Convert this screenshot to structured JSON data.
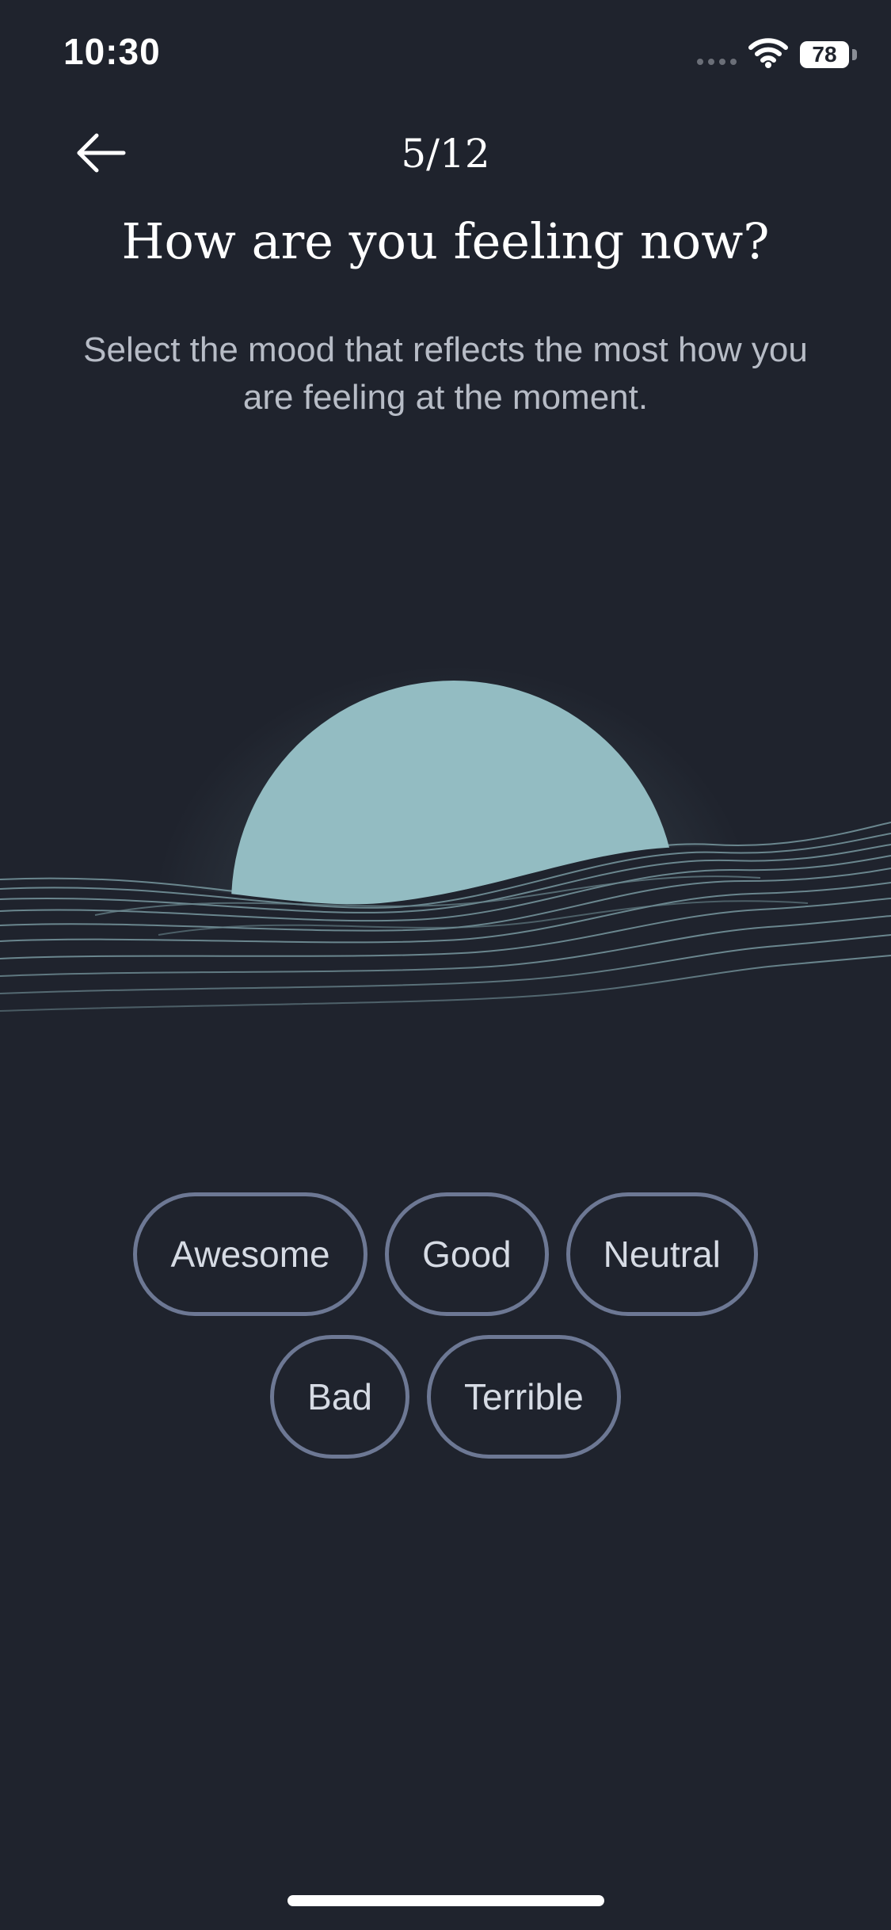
{
  "status_bar": {
    "time": "10:30",
    "battery": "78"
  },
  "header": {
    "progress": "5/12",
    "title": "How are you feeling now?",
    "subtitle": "Select the mood that reflects the most how you are feeling at the moment."
  },
  "moods": {
    "row1": [
      "Awesome",
      "Good",
      "Neutral"
    ],
    "row2": [
      "Bad",
      "Terrible"
    ]
  },
  "colors": {
    "background": "#1f232d",
    "sun": "#93bcc2",
    "chip_border": "#6d7894",
    "text": "#ffffff",
    "subtitle": "#b7bcc6"
  },
  "icons": {
    "back": "arrow-left-icon",
    "wifi": "wifi-icon",
    "signal": "cellular-signal-icon",
    "battery": "battery-icon"
  }
}
